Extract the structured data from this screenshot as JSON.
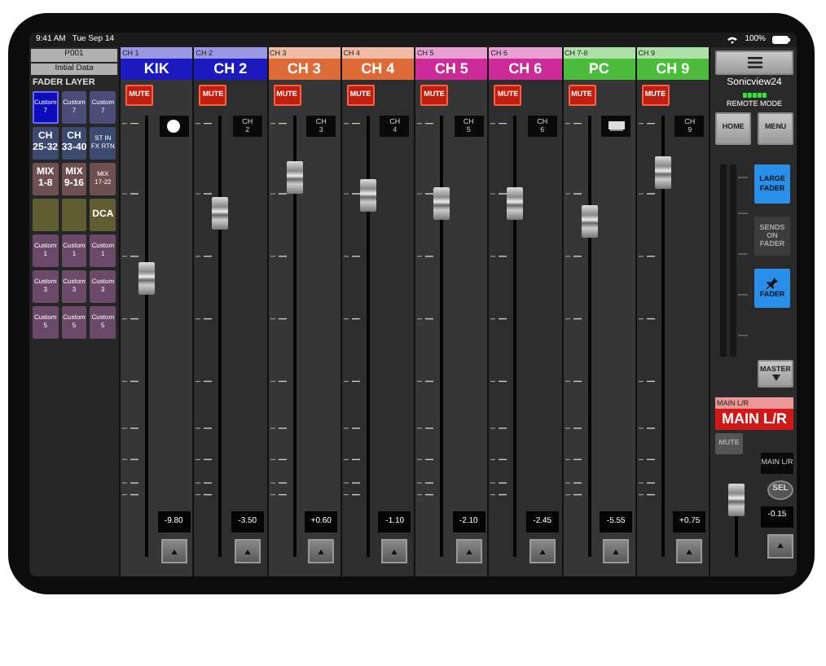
{
  "status_bar": {
    "time": "9:41 AM",
    "date": "Tue Sep 14",
    "battery": "100%"
  },
  "scene": {
    "number": "P001",
    "name": "Initial Data"
  },
  "fader_layer": {
    "title": "FADER LAYER",
    "buttons": [
      {
        "kind": "custom_top",
        "lines": [
          "Custom",
          "7"
        ],
        "selected": true
      },
      {
        "kind": "custom_top",
        "lines": [
          "Custom",
          "7"
        ],
        "selected": false
      },
      {
        "kind": "custom_top",
        "lines": [
          "Custom",
          "7"
        ],
        "selected": false
      },
      {
        "kind": "ch",
        "lines": [
          "CH",
          "25-32"
        ],
        "selected": false
      },
      {
        "kind": "ch",
        "lines": [
          "CH",
          "33-40"
        ],
        "selected": false
      },
      {
        "kind": "ch_small",
        "lines": [
          "ST IN",
          "FX RTN"
        ],
        "selected": false
      },
      {
        "kind": "mix",
        "lines": [
          "MIX",
          "1-8"
        ],
        "selected": false
      },
      {
        "kind": "mix",
        "lines": [
          "MIX",
          "9-16"
        ],
        "selected": false
      },
      {
        "kind": "mix_small",
        "lines": [
          "MIX",
          "17-22"
        ],
        "selected": false
      },
      {
        "kind": "blank",
        "selected": false
      },
      {
        "kind": "blank",
        "selected": false
      },
      {
        "kind": "dca",
        "lines": [
          "DCA"
        ],
        "selected": false
      },
      {
        "kind": "custom",
        "lines": [
          "Custom",
          "1"
        ],
        "selected": false
      },
      {
        "kind": "custom",
        "lines": [
          "Custom",
          "1"
        ],
        "selected": false
      },
      {
        "kind": "custom",
        "lines": [
          "Custom",
          "1"
        ],
        "selected": false
      },
      {
        "kind": "custom",
        "lines": [
          "Custom",
          "3"
        ],
        "selected": false
      },
      {
        "kind": "custom",
        "lines": [
          "Custom",
          "3"
        ],
        "selected": false
      },
      {
        "kind": "custom",
        "lines": [
          "Custom",
          "3"
        ],
        "selected": false
      },
      {
        "kind": "custom",
        "lines": [
          "Custom",
          "5"
        ],
        "selected": false
      },
      {
        "kind": "custom",
        "lines": [
          "Custom",
          "5"
        ],
        "selected": false
      },
      {
        "kind": "custom",
        "lines": [
          "Custom",
          "5"
        ],
        "selected": false
      }
    ]
  },
  "strips": [
    {
      "channel": "CH 1",
      "name": "KIK",
      "color": "#1a1ac0",
      "mute": "MUTE",
      "muted": true,
      "tag": {
        "kind": "circle"
      },
      "level": 0.63,
      "value": "-9.80"
    },
    {
      "channel": "CH 2",
      "name": "CH 2",
      "color": "#1a1ac0",
      "mute": "MUTE",
      "muted": true,
      "tag": {
        "kind": "text",
        "lines": [
          "CH",
          "2"
        ]
      },
      "level": 0.78,
      "value": "-3.50"
    },
    {
      "channel": "CH 3",
      "name": "CH 3",
      "color": "#de6a38",
      "mute": "MUTE",
      "muted": true,
      "tag": {
        "kind": "text",
        "lines": [
          "CH",
          "3"
        ]
      },
      "level": 0.86,
      "value": "+0.60"
    },
    {
      "channel": "CH 4",
      "name": "CH 4",
      "color": "#de6a38",
      "mute": "MUTE",
      "muted": true,
      "tag": {
        "kind": "text",
        "lines": [
          "CH",
          "4"
        ]
      },
      "level": 0.82,
      "value": "-1.10"
    },
    {
      "channel": "CH 5",
      "name": "CH 5",
      "color": "#cc2a98",
      "mute": "MUTE",
      "muted": true,
      "tag": {
        "kind": "text",
        "lines": [
          "CH",
          "5"
        ]
      },
      "level": 0.8,
      "value": "-2.10"
    },
    {
      "channel": "CH 6",
      "name": "CH 6",
      "color": "#cc2a98",
      "mute": "MUTE",
      "muted": true,
      "tag": {
        "kind": "text",
        "lines": [
          "CH",
          "6"
        ]
      },
      "level": 0.8,
      "value": "-2.45"
    },
    {
      "channel": "CH 7-8",
      "name": "PC",
      "color": "#4cbc3c",
      "mute": "MUTE",
      "muted": true,
      "tag": {
        "kind": "device"
      },
      "level": 0.76,
      "value": "-5.55"
    },
    {
      "channel": "CH 9",
      "name": "CH 9",
      "color": "#4cbc3c",
      "mute": "MUTE",
      "muted": true,
      "tag": {
        "kind": "text",
        "lines": [
          "CH",
          "9"
        ]
      },
      "level": 0.87,
      "value": "+0.75"
    }
  ],
  "right_panel": {
    "device": "Sonicview24",
    "remote_mode": "REMOTE MODE",
    "buttons": [
      "HOME",
      "MENU"
    ],
    "modes": [
      {
        "kind": "text",
        "label": "LARGE FADER",
        "selected": true
      },
      {
        "kind": "text",
        "label": "SENDS ON FADER",
        "selected": false
      },
      {
        "kind": "pin",
        "label": "FADER",
        "selected": true
      }
    ],
    "master": "MASTER",
    "main": {
      "channel": "MAIN L/R",
      "name": "MAIN L/R",
      "color": "#d01818",
      "mute": "MUTE",
      "muted": false,
      "label": "MAIN L/R",
      "sel": "SEL",
      "level": 0.78,
      "value": "-0.15"
    }
  }
}
